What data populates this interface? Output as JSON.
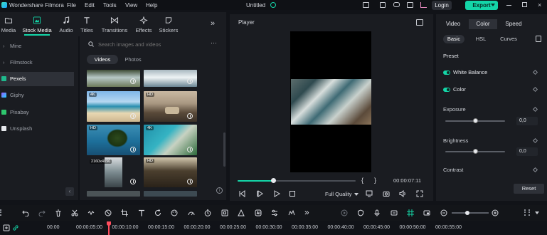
{
  "app": {
    "name": "Wondershare Filmora",
    "menus": [
      "File",
      "Edit",
      "Tools",
      "View",
      "Help"
    ],
    "project_title": "Untitled",
    "login_label": "Login",
    "export_label": "Export"
  },
  "media_tabs": [
    {
      "label": "Media",
      "icon": "folder-icon"
    },
    {
      "label": "Stock Media",
      "icon": "stock-media-icon",
      "active": true
    },
    {
      "label": "Audio",
      "icon": "music-note-icon"
    },
    {
      "label": "Titles",
      "icon": "text-t-icon"
    },
    {
      "label": "Transitions",
      "icon": "transition-icon"
    },
    {
      "label": "Effects",
      "icon": "sparkle-icon"
    },
    {
      "label": "Stickers",
      "icon": "sticker-icon"
    }
  ],
  "library": {
    "items": [
      {
        "label": "Mine",
        "expandable": true
      },
      {
        "label": "Filmstock",
        "expandable": true
      },
      {
        "label": "Pexels",
        "active": true
      },
      {
        "label": "Giphy"
      },
      {
        "label": "Pixabay"
      },
      {
        "label": "Unsplash"
      }
    ]
  },
  "search": {
    "placeholder": "Search images and videos"
  },
  "segments": {
    "videos": "Videos",
    "photos": "Photos"
  },
  "thumbnails": [
    {
      "badge": "",
      "scene": "waterfall"
    },
    {
      "badge": "",
      "scene": "wave"
    },
    {
      "badge": "4K",
      "scene": "beach"
    },
    {
      "badge": "HD",
      "scene": "van"
    },
    {
      "badge": "HD",
      "scene": "palm"
    },
    {
      "badge": "4K",
      "scene": "coast"
    },
    {
      "badge": "2160x4096",
      "scene": "portrait"
    },
    {
      "badge": "HD",
      "scene": "driftwood"
    }
  ],
  "player": {
    "title": "Player",
    "progress": 0.3,
    "timecode": "00:00:07:11",
    "quality_label": "Full Quality",
    "brace_open": "{",
    "brace_close": "}"
  },
  "right_panel": {
    "tabs": [
      "Video",
      "Color",
      "Speed"
    ],
    "active_tab": "Color",
    "subtabs": [
      "Basic",
      "HSL",
      "Curves"
    ],
    "active_subtab": "Basic",
    "preset_label": "Preset",
    "white_balance_label": "White Balance",
    "color_label": "Color",
    "exposure_label": "Exposure",
    "exposure_value": "0,0",
    "brightness_label": "Brightness",
    "brightness_value": "0,0",
    "contrast_label": "Contrast",
    "reset_label": "Reset"
  },
  "timeline": {
    "ticks": [
      "00:00",
      "00:00:05:00",
      "00:00:10:00",
      "00:00:15:00",
      "00:00:20:00",
      "00:00:25:00",
      "00:00:30:00",
      "00:00:35:00",
      "00:00:40:00",
      "00:00:45:00",
      "00:00:50:00",
      "00:00:55:00"
    ]
  },
  "colors": {
    "accent": "#14d6a8",
    "panel": "#1a1c21",
    "background": "#111318",
    "playhead": "#ff4d5e"
  }
}
